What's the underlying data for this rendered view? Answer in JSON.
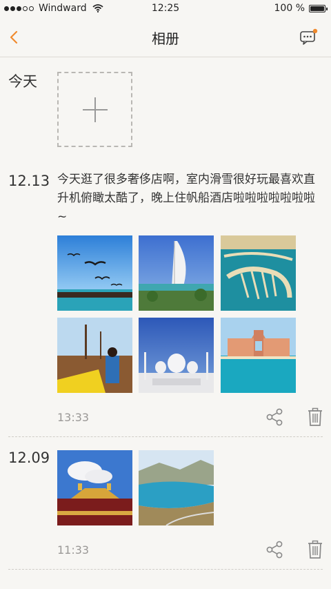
{
  "status_bar": {
    "carrier": "Windward",
    "time": "12:25",
    "battery": "100 %",
    "signal_icon": "signal-dots-icon",
    "wifi_icon": "wifi-icon",
    "battery_icon": "battery-icon"
  },
  "nav": {
    "title": "相册",
    "back_icon": "chevron-left-icon",
    "message_icon": "message-bubble-icon",
    "accent_color": "#f08a2e"
  },
  "today": {
    "label": "今天",
    "add_icon": "plus-icon"
  },
  "posts": [
    {
      "date": "12.13",
      "text": "今天逛了很多奢侈店啊，室内滑雪很好玩最喜欢直升机俯瞰太酷了，晚上住帆船酒店啦啦啦啦啦啦啦~",
      "time": "13:33",
      "photos": [
        "seagulls-harbor",
        "burj-al-arab",
        "palm-island-aerial",
        "dhow-boat-girl",
        "grand-mosque",
        "atlantis-hotel"
      ]
    },
    {
      "date": "12.09",
      "time": "11:33",
      "photos": [
        "potala-palace-roof",
        "mountain-lake"
      ]
    }
  ],
  "actions": {
    "share_icon": "share-icon",
    "delete_icon": "trash-icon"
  }
}
